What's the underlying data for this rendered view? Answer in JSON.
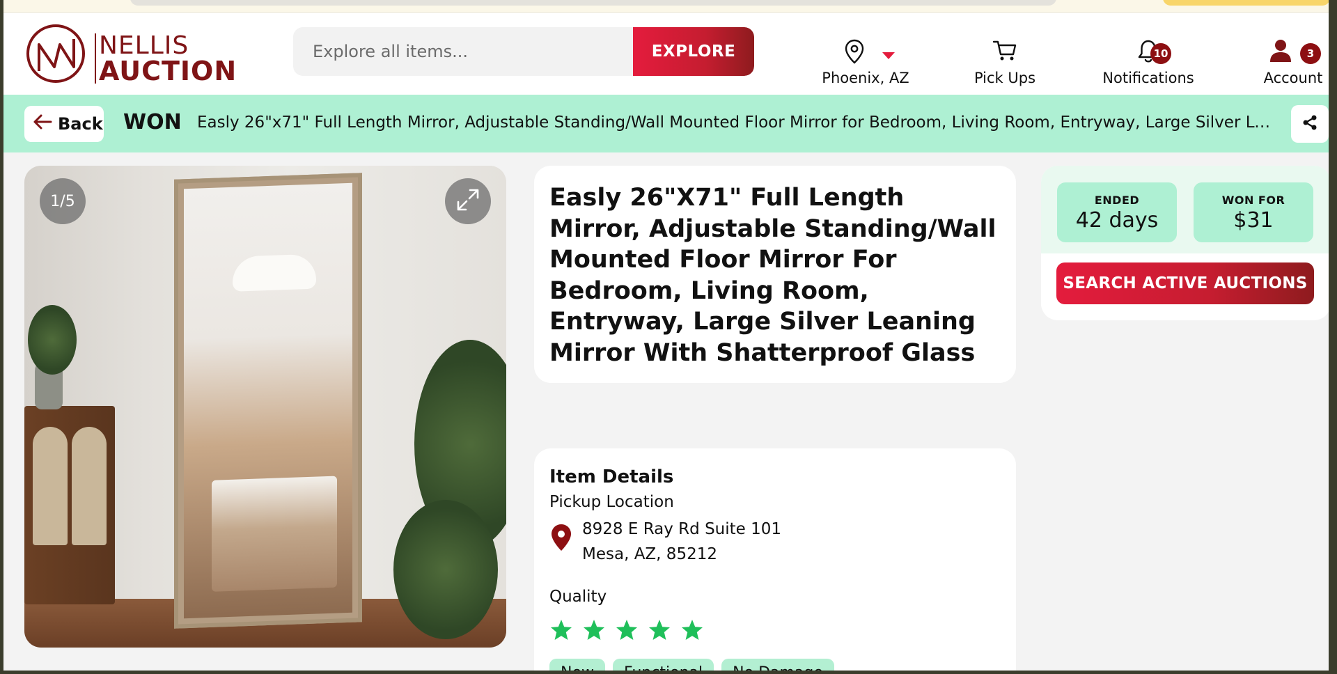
{
  "header": {
    "logo_line1": "NELLIS",
    "logo_line2": "AUCTION",
    "search_placeholder": "Explore all items...",
    "search_button": "EXPLORE",
    "location": "Phoenix, AZ",
    "pickups": "Pick Ups",
    "notifications": "Notifications",
    "notifications_count": "10",
    "account": "Account",
    "account_count": "3"
  },
  "status_bar": {
    "back_label": "Back",
    "status": "WON",
    "item_title": "Easly 26\"x71\" Full Length Mirror, Adjustable Standing/Wall Mounted Floor Mirror for Bedroom, Living Room, Entryway, Large Silver Leaning..."
  },
  "gallery": {
    "counter": "1/5"
  },
  "item": {
    "title": "Easly 26\"X71\" Full Length Mirror, Adjustable Standing/Wall Mounted Floor Mirror For Bedroom, Living Room, Entryway, Large Silver Leaning Mirror With Shatterproof Glass"
  },
  "details": {
    "heading": "Item Details",
    "pickup_label": "Pickup Location",
    "address_line1": "8928 E Ray Rd Suite 101",
    "address_line2": "Mesa, AZ, 85212",
    "quality_label": "Quality",
    "stars": 5,
    "tags": [
      "New",
      "Functional",
      "No Damage"
    ]
  },
  "auction": {
    "ended_label": "ENDED",
    "ended_value": "42 days",
    "won_label": "WON FOR",
    "won_value": "$31",
    "cta": "SEARCH ACTIVE AUCTIONS"
  },
  "colors": {
    "brand": "#7f1416",
    "accent_red": "#e41c3d",
    "mint": "#aef0d3",
    "star": "#1fbf5a"
  }
}
